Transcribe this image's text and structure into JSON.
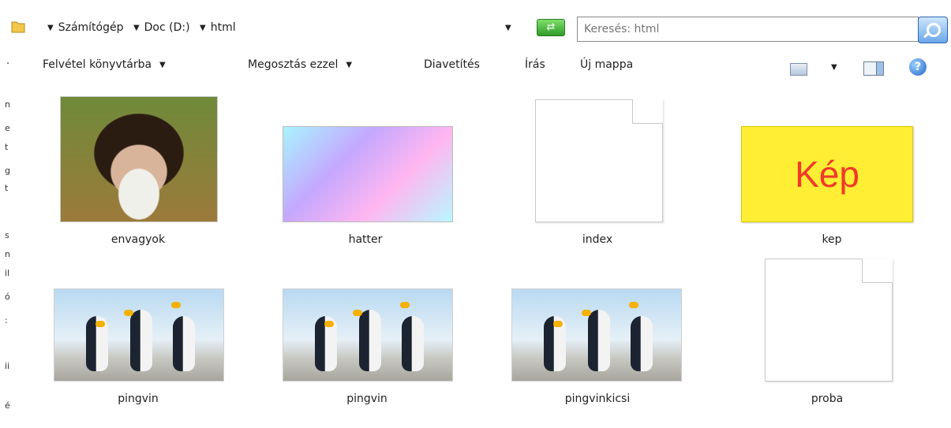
{
  "address_bar": {
    "breadcrumbs": [
      "Számítógép",
      "Doc (D:)",
      "html"
    ],
    "search_placeholder": "Keresés: html"
  },
  "toolbar": {
    "items": [
      "Felvétel könyvtárba",
      "Megosztás ezzel",
      "Diavetítés",
      "Írás",
      "Új mappa"
    ]
  },
  "left_pane_glyphs": [
    "n",
    "e",
    "t",
    "g",
    "t",
    "s",
    "n",
    "il",
    "ó",
    ":",
    "ii",
    "é"
  ],
  "files": [
    {
      "name": "envagyok",
      "kind": "image",
      "icon": "monkey-photo"
    },
    {
      "name": "hatter",
      "kind": "image",
      "icon": "gradient-image"
    },
    {
      "name": "index",
      "kind": "document",
      "icon": "blank-document"
    },
    {
      "name": "kep",
      "kind": "image",
      "icon": "kep-image",
      "thumb_text": "Kép"
    },
    {
      "name": "pingvin",
      "kind": "image",
      "icon": "penguin-photo"
    },
    {
      "name": "pingvin",
      "kind": "image",
      "icon": "penguin-photo"
    },
    {
      "name": "pingvinkicsi",
      "kind": "image",
      "icon": "penguin-photo"
    },
    {
      "name": "proba",
      "kind": "document",
      "icon": "blank-document"
    }
  ]
}
